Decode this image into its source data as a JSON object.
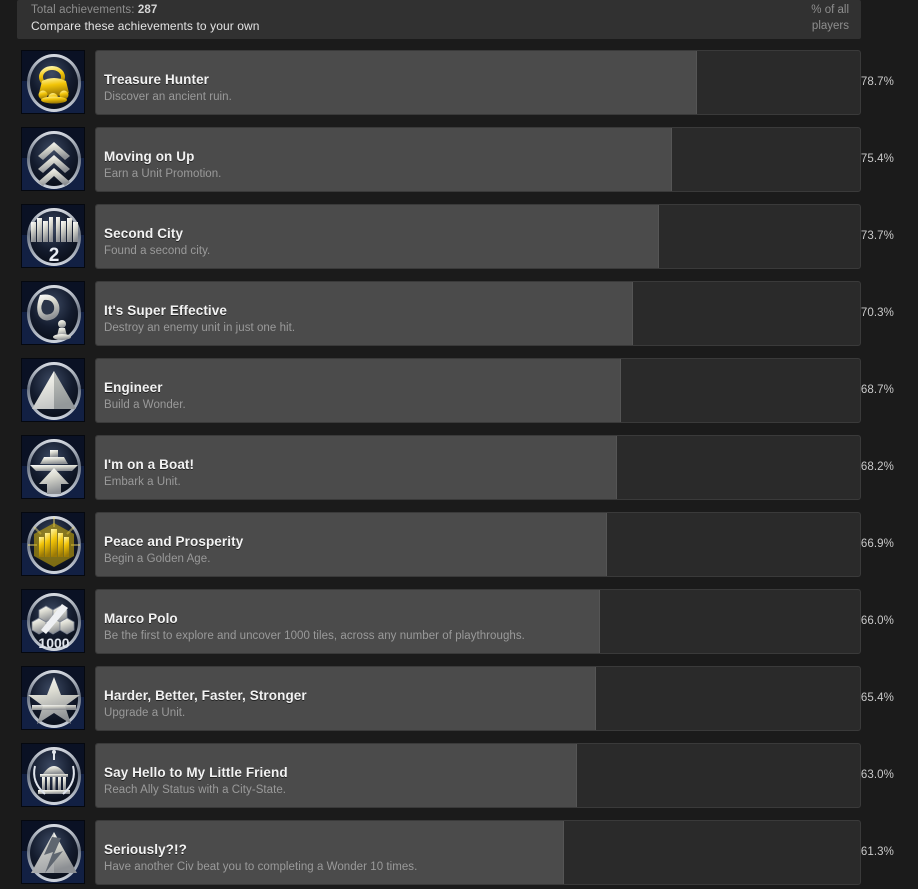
{
  "header": {
    "total_label": "Total achievements:",
    "total_count": "287",
    "compare_link": "Compare these achievements to your own",
    "pct_line1": "% of all",
    "pct_line2": "players"
  },
  "colors": {
    "page_bg": "#1b1b1b",
    "header_bg": "#313131",
    "bar_track": "#2a2a2a",
    "bar_fill": "#4b4b4b",
    "title_text": "#f2f2f2",
    "desc_text": "#9a9a9a",
    "pct_text": "#c9c9c9"
  },
  "achievements": [
    {
      "icon": "gold-treasure-icon",
      "title": "Treasure Hunter",
      "description": "Discover an ancient ruin.",
      "percent_label": "78.7%",
      "percent_value": 78.7
    },
    {
      "icon": "chevrons-icon",
      "title": "Moving on Up",
      "description": "Earn a Unit Promotion.",
      "percent_label": "75.4%",
      "percent_value": 75.4
    },
    {
      "icon": "city-two-icon",
      "title": "Second City",
      "description": "Found a second city.",
      "percent_label": "73.7%",
      "percent_value": 73.7
    },
    {
      "icon": "boot-stomp-icon",
      "title": "It's Super Effective",
      "description": "Destroy an enemy unit in just one hit.",
      "percent_label": "70.3%",
      "percent_value": 70.3
    },
    {
      "icon": "pyramid-icon",
      "title": "Engineer",
      "description": "Build a Wonder.",
      "percent_label": "68.7%",
      "percent_value": 68.7
    },
    {
      "icon": "boat-arrow-icon",
      "title": "I'm on a Boat!",
      "description": "Embark a Unit.",
      "percent_label": "68.2%",
      "percent_value": 68.2
    },
    {
      "icon": "golden-city-icon",
      "title": "Peace and Prosperity",
      "description": "Begin a Golden Age.",
      "percent_label": "66.9%",
      "percent_value": 66.9
    },
    {
      "icon": "hex-tiles-1000-icon",
      "title": "Marco Polo",
      "description": "Be the first to explore and uncover 1000 tiles, across any number of playthroughs.",
      "percent_label": "66.0%",
      "percent_value": 66.0
    },
    {
      "icon": "star-upgrade-icon",
      "title": "Harder, Better, Faster, Stronger",
      "description": "Upgrade a Unit.",
      "percent_label": "65.4%",
      "percent_value": 65.4
    },
    {
      "icon": "capitol-laurel-icon",
      "title": "Say Hello to My Little Friend",
      "description": "Reach Ally Status with a City-State.",
      "percent_label": "63.0%",
      "percent_value": 63.0
    },
    {
      "icon": "pyramid-crack-icon",
      "title": "Seriously?!?",
      "description": "Have another Civ beat you to completing a Wonder 10 times.",
      "percent_label": "61.3%",
      "percent_value": 61.3
    }
  ]
}
